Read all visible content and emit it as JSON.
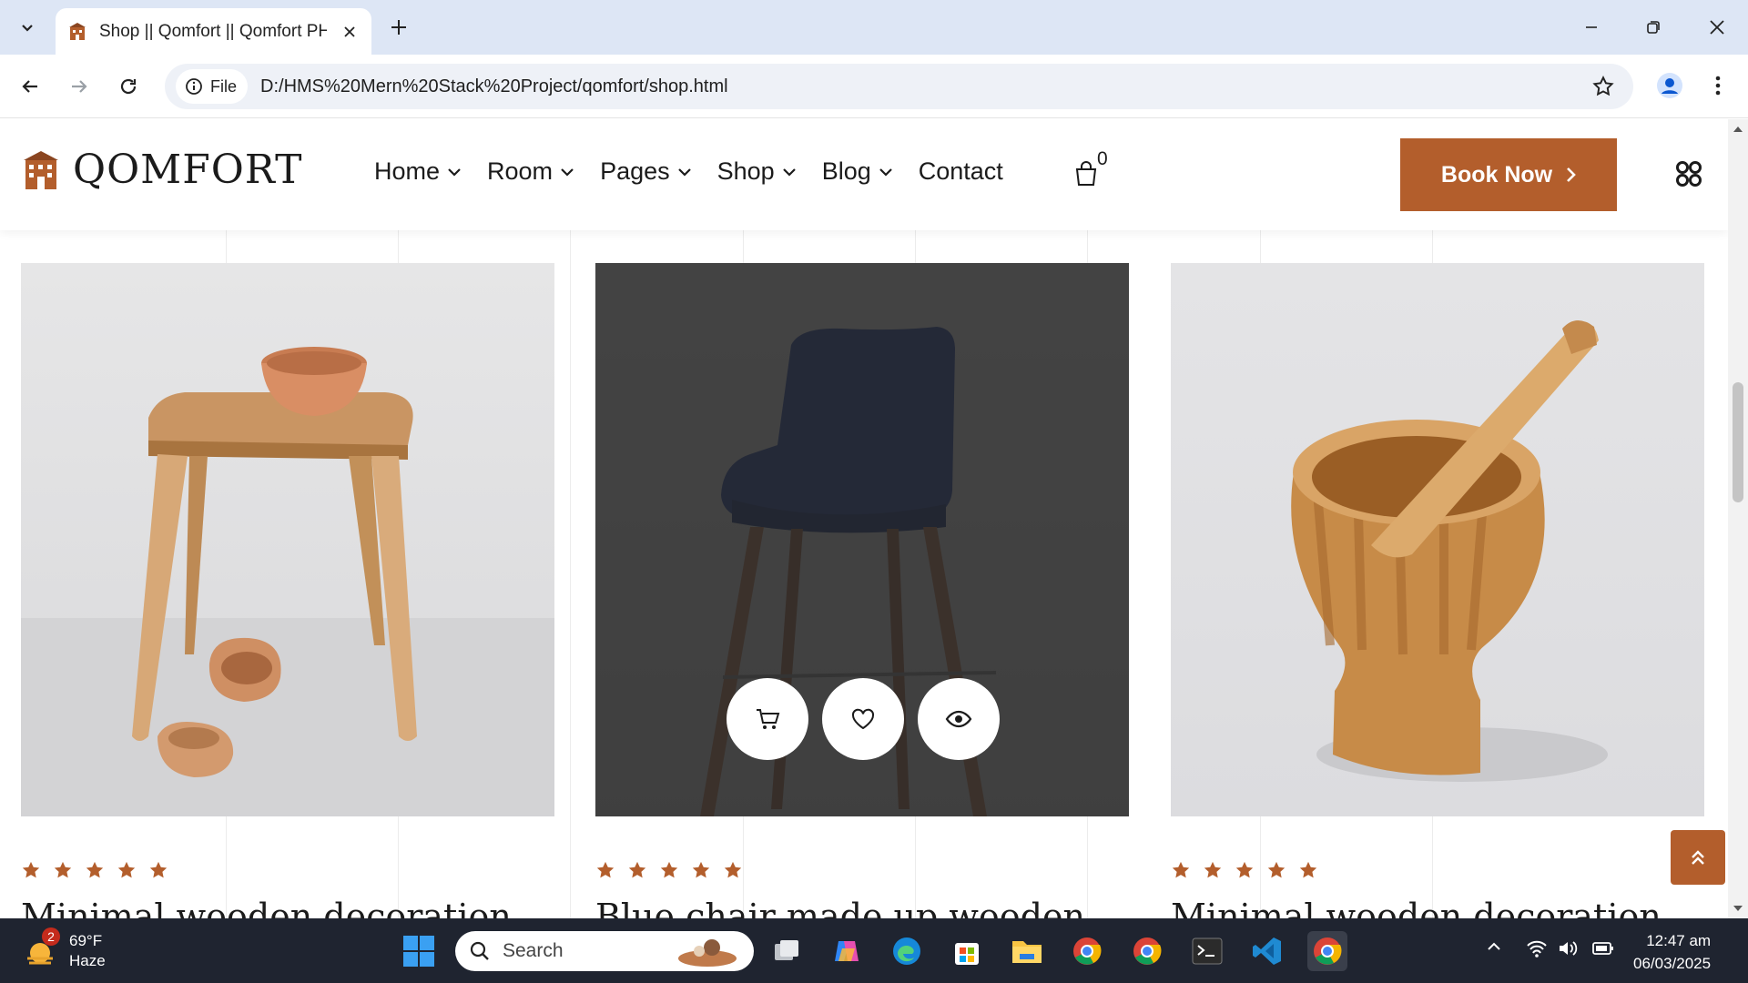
{
  "browser": {
    "tab_title": "Shop || Qomfort || Qomfort PHP",
    "url_chip_label": "File",
    "url": "D:/HMS%20Mern%20Stack%20Project/qomfort/shop.html"
  },
  "site": {
    "logo_text": "QOMFORT",
    "nav": [
      {
        "label": "Home",
        "dropdown": true
      },
      {
        "label": "Room",
        "dropdown": true
      },
      {
        "label": "Pages",
        "dropdown": true
      },
      {
        "label": "Shop",
        "dropdown": true
      },
      {
        "label": "Blog",
        "dropdown": true
      },
      {
        "label": "Contact",
        "dropdown": false
      }
    ],
    "cart_count": "0",
    "book_button": "Book Now",
    "accent_color": "#b35e2c"
  },
  "products": [
    {
      "title": "Minimal wooden decoration",
      "rating": 5,
      "image": "wooden-stool-with-clay-bowls"
    },
    {
      "title": "Blue chair made up wooden",
      "rating": 5,
      "image": "blue-tufted-bar-chair",
      "hover_actions": [
        "cart-icon",
        "heart-icon",
        "eye-icon"
      ]
    },
    {
      "title": "Minimal wooden decoration",
      "rating": 5,
      "image": "wooden-mortar-and-pestle"
    }
  ],
  "taskbar": {
    "weather_badge": "2",
    "temperature": "69°F",
    "condition": "Haze",
    "search_placeholder": "Search",
    "time": "12:47 am",
    "date": "06/03/2025"
  }
}
